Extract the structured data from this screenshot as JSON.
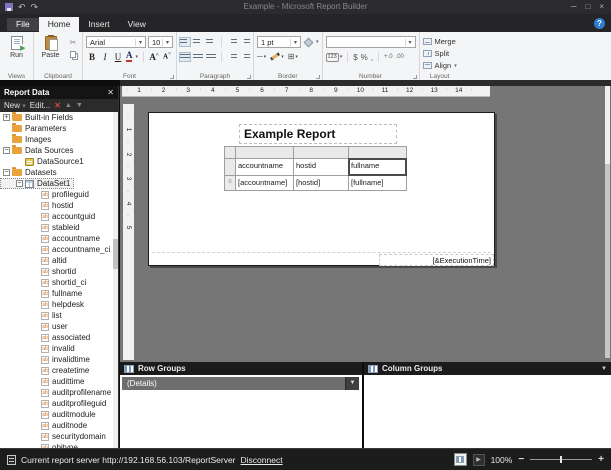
{
  "window": {
    "title": "Example - Microsoft Report Builder",
    "minimize": "─",
    "maximize": "□",
    "close": "×",
    "help": "?"
  },
  "tabs": {
    "file": "File",
    "home": "Home",
    "insert": "Insert",
    "view": "View"
  },
  "ribbon": {
    "views": {
      "label": "Views",
      "run": "Run"
    },
    "clipboard": {
      "label": "Clipboard",
      "paste": "Paste"
    },
    "font": {
      "label": "Font",
      "family": "Arial",
      "size": "10",
      "bold": "B",
      "italic": "I",
      "underline": "U",
      "color_glyph": "A",
      "grow_glyph": "A",
      "shrink_glyph": "A"
    },
    "paragraph": {
      "label": "Paragraph"
    },
    "border": {
      "label": "Border",
      "width": "1 pt",
      "line_glyph": "─"
    },
    "number": {
      "label": "Number",
      "badge": "123",
      "currency": "$",
      "percent": "%",
      "comma": ",",
      "inc_decimal": "+.0",
      "dec_decimal": ".00"
    },
    "layout": {
      "label": "Layout",
      "merge": "Merge",
      "split": "Split",
      "align": "Align"
    }
  },
  "report_data": {
    "title": "Report Data",
    "toolbar": {
      "new_label": "New",
      "edit_label": "Edit...",
      "delete_glyph": "✕",
      "up_glyph": "▲",
      "down_glyph": "▼"
    },
    "tree": [
      {
        "label": "Built-in Fields",
        "lvl": 0,
        "icon": "folder",
        "exp": "+"
      },
      {
        "label": "Parameters",
        "lvl": 0,
        "icon": "folder",
        "exp": ""
      },
      {
        "label": "Images",
        "lvl": 0,
        "icon": "folder",
        "exp": ""
      },
      {
        "label": "Data Sources",
        "lvl": 0,
        "icon": "folder",
        "exp": "-"
      },
      {
        "label": "DataSource1",
        "lvl": 1,
        "icon": "db",
        "exp": ""
      },
      {
        "label": "Datasets",
        "lvl": 0,
        "icon": "folder",
        "exp": "-"
      },
      {
        "label": "DataSet1",
        "lvl": 1,
        "icon": "dataset",
        "exp": "-",
        "sel": true
      },
      {
        "label": "profileguid",
        "lvl": 2,
        "icon": "field",
        "exp": ""
      },
      {
        "label": "hostid",
        "lvl": 2,
        "icon": "field",
        "exp": ""
      },
      {
        "label": "accountguid",
        "lvl": 2,
        "icon": "field",
        "exp": ""
      },
      {
        "label": "stableid",
        "lvl": 2,
        "icon": "field",
        "exp": ""
      },
      {
        "label": "accountname",
        "lvl": 2,
        "icon": "field",
        "exp": ""
      },
      {
        "label": "accountname_ci",
        "lvl": 2,
        "icon": "field",
        "exp": ""
      },
      {
        "label": "altid",
        "lvl": 2,
        "icon": "field",
        "exp": ""
      },
      {
        "label": "shortid",
        "lvl": 2,
        "icon": "field",
        "exp": ""
      },
      {
        "label": "shortid_ci",
        "lvl": 2,
        "icon": "field",
        "exp": ""
      },
      {
        "label": "fullname",
        "lvl": 2,
        "icon": "field",
        "exp": ""
      },
      {
        "label": "helpdesk",
        "lvl": 2,
        "icon": "field",
        "exp": ""
      },
      {
        "label": "list",
        "lvl": 2,
        "icon": "field",
        "exp": ""
      },
      {
        "label": "user",
        "lvl": 2,
        "icon": "field",
        "exp": ""
      },
      {
        "label": "associated",
        "lvl": 2,
        "icon": "field",
        "exp": ""
      },
      {
        "label": "invalid",
        "lvl": 2,
        "icon": "field",
        "exp": ""
      },
      {
        "label": "invalidtime",
        "lvl": 2,
        "icon": "field",
        "exp": ""
      },
      {
        "label": "createtime",
        "lvl": 2,
        "icon": "field",
        "exp": ""
      },
      {
        "label": "audittime",
        "lvl": 2,
        "icon": "field",
        "exp": ""
      },
      {
        "label": "auditprofilename",
        "lvl": 2,
        "icon": "field",
        "exp": ""
      },
      {
        "label": "auditprofileguid",
        "lvl": 2,
        "icon": "field",
        "exp": ""
      },
      {
        "label": "auditmodule",
        "lvl": 2,
        "icon": "field",
        "exp": ""
      },
      {
        "label": "auditnode",
        "lvl": 2,
        "icon": "field",
        "exp": ""
      },
      {
        "label": "securitydomain",
        "lvl": 2,
        "icon": "field",
        "exp": ""
      },
      {
        "label": "objtype",
        "lvl": 2,
        "icon": "field",
        "exp": ""
      }
    ]
  },
  "design": {
    "ruler_h": [
      "1",
      "2",
      "3",
      "4",
      "5",
      "6",
      "7",
      "8",
      "9",
      "10",
      "11",
      "12",
      "13",
      "14"
    ],
    "ruler_v": [
      "1",
      "2",
      "3",
      "4",
      "5"
    ],
    "report_title": "Example Report",
    "table": {
      "columns": [
        "accountname",
        "hostid",
        "fullname"
      ],
      "data_row": [
        "[accountname]",
        "[hostid]",
        "[fullname]"
      ],
      "row_handle_glyph": "≡"
    },
    "footer_expression": "[&ExecutionTime]"
  },
  "groups": {
    "row": {
      "label": "Row Groups",
      "details": "(Details)"
    },
    "column": {
      "label": "Column Groups"
    }
  },
  "statusbar": {
    "message": "Current report server http://192.168.56.103/ReportServer",
    "disconnect": "Disconnect",
    "zoom": "100%",
    "minus": "−",
    "plus": "+"
  }
}
